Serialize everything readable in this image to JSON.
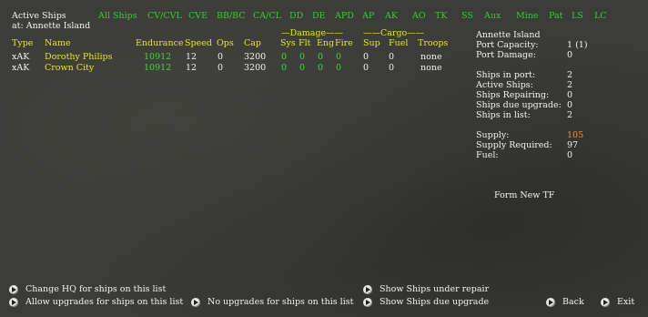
{
  "header": {
    "title": "Active Ships",
    "location": "at: Annette Island"
  },
  "filters": [
    "All Ships",
    "CV/CVL",
    "CVE",
    "BB/BC",
    "CA/CL",
    "DD",
    "DE",
    "APD",
    "AP",
    "AK",
    "AO",
    "TK",
    "SS",
    "Aux",
    "Mine",
    "Pat",
    "LS",
    "LC"
  ],
  "groups": {
    "damage": "—Damage——",
    "cargo": "——Cargo——"
  },
  "columns": [
    "Type",
    "Name",
    "Endurance",
    "Speed",
    "Ops",
    "Cap",
    "Sys",
    "Flt",
    "Eng",
    "Fire",
    "Sup",
    "Fuel",
    "Troops"
  ],
  "ships": [
    {
      "type": "xAK",
      "name": "Dorothy Philips",
      "endurance": "10912",
      "speed": "12",
      "ops": "0",
      "cap": "3200",
      "sys": "0",
      "flt": "0",
      "eng": "0",
      "fire": "0",
      "sup": "0",
      "fuel": "0",
      "troops": "none"
    },
    {
      "type": "xAK",
      "name": "Crown City",
      "endurance": "10912",
      "speed": "12",
      "ops": "0",
      "cap": "3200",
      "sys": "0",
      "flt": "0",
      "eng": "0",
      "fire": "0",
      "sup": "0",
      "fuel": "0",
      "troops": "none"
    }
  ],
  "port": {
    "name": "Annette Island",
    "rows_a": [
      {
        "label": "Port Capacity:",
        "value": "1 (1)"
      },
      {
        "label": "Port Damage:",
        "value": "0"
      }
    ],
    "rows_b": [
      {
        "label": "Ships in port:",
        "value": "2"
      },
      {
        "label": "Active Ships:",
        "value": "2"
      },
      {
        "label": "Ships Repairing:",
        "value": "0"
      },
      {
        "label": "Ships due upgrade:",
        "value": "0"
      },
      {
        "label": "Ships in list:",
        "value": "2"
      }
    ],
    "rows_c": [
      {
        "label": "Supply:",
        "value": "105"
      },
      {
        "label": "Supply Required:",
        "value": "97"
      },
      {
        "label": "Fuel:",
        "value": "0"
      }
    ],
    "form_tf": "Form New TF"
  },
  "actions": {
    "change_hq": "Change HQ for ships on this list",
    "allow_upgrades": "Allow upgrades for ships on this list",
    "no_upgrades": "No upgrades for ships on this list",
    "show_repair": "Show Ships under repair",
    "show_upgrade": "Show Ships due upgrade",
    "back": "Back",
    "exit": "Exit"
  },
  "colors": {
    "filter_green": "#2fd12f",
    "header_yellow": "#e6e633",
    "value_green": "#3fd63f",
    "supply_orange": "#ff8c3a",
    "background": "#3b3b37"
  }
}
